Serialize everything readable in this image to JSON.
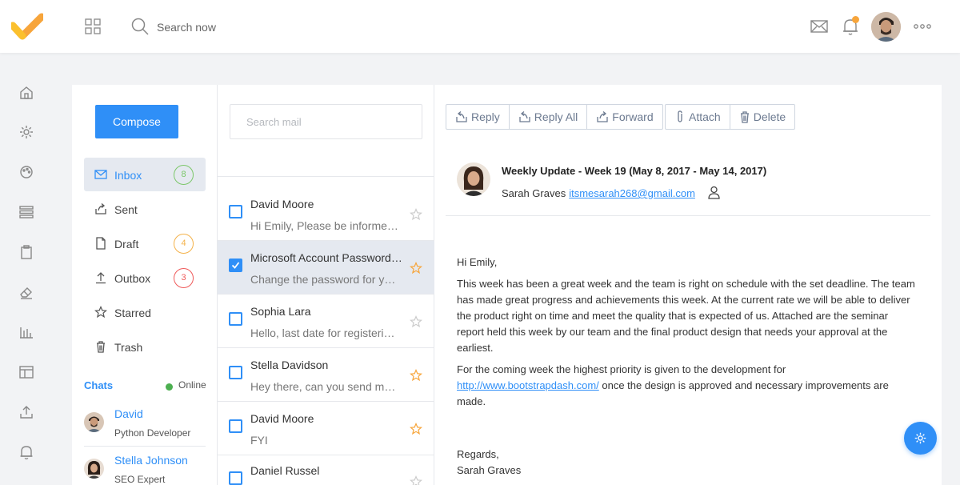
{
  "topbar": {
    "search_label": "Search now"
  },
  "colors": {
    "accent": "#2f8ff7",
    "logo_orange": "#f7a53b",
    "selected_row": "#e5e9f0",
    "badge_green": "#7cc76a",
    "badge_orange": "#f4b24a",
    "badge_red": "#ef5a5a"
  },
  "sidebar_rail": {
    "icons": [
      "home-icon",
      "settings-icon",
      "palette-icon",
      "list-icon",
      "clipboard-icon",
      "eraser-icon",
      "bar-chart-icon",
      "layout-icon",
      "upload-icon",
      "bell-icon"
    ]
  },
  "folders": {
    "compose_label": "Compose",
    "items": [
      {
        "label": "Inbox",
        "badge": "8",
        "icon": "mail-icon"
      },
      {
        "label": "Sent",
        "badge": "",
        "icon": "share-icon"
      },
      {
        "label": "Draft",
        "badge": "4",
        "icon": "file-icon"
      },
      {
        "label": "Outbox",
        "badge": "3",
        "icon": "upload-icon"
      },
      {
        "label": "Starred",
        "badge": "",
        "icon": "star-icon"
      },
      {
        "label": "Trash",
        "badge": "",
        "icon": "trash-icon"
      }
    ],
    "chats_title": "Chats",
    "online_label": "Online",
    "chats": [
      {
        "name": "David",
        "role": "Python Developer"
      },
      {
        "name": "Stella Johnson",
        "role": "SEO Expert"
      }
    ]
  },
  "message_list": {
    "search_placeholder": "Search mail",
    "messages": [
      {
        "sender": "David Moore",
        "preview": "Hi Emily, Please be informed t...",
        "checked": false,
        "starred": false
      },
      {
        "sender": "Microsoft Account Password ...",
        "preview": "Change the password for your...",
        "checked": true,
        "starred": true
      },
      {
        "sender": "Sophia Lara",
        "preview": "Hello, last date for registering ...",
        "checked": false,
        "starred": false
      },
      {
        "sender": "Stella Davidson",
        "preview": "Hey there, can you send me th...",
        "checked": false,
        "starred": true
      },
      {
        "sender": "David Moore",
        "preview": "FYI",
        "checked": false,
        "starred": true
      },
      {
        "sender": "Daniel Russel",
        "preview": "",
        "checked": false,
        "starred": false
      }
    ]
  },
  "toolbar": {
    "reply": "Reply",
    "reply_all": "Reply All",
    "forward": "Forward",
    "attach": "Attach",
    "delete": "Delete"
  },
  "reader": {
    "subject": "Weekly Update - Week 19 (May 8, 2017 - May 14, 2017)",
    "from_name": "Sarah Graves",
    "from_email": "itsmesarah268@gmail.com",
    "greeting": "Hi Emily,",
    "paragraph1": "This week has been a great week and the team is right on schedule with the set deadline. The team has made great progress and achievements this week. At the current rate we will be able to deliver the product right on time and meet the quality that is expected of us. Attached are the seminar report held this week by our team and the final product design that needs your approval at the earliest.",
    "paragraph2_start": "For the coming week the highest priority is given to the development for",
    "paragraph2_link": "http://www.bootstrapdash.com/",
    "paragraph2_end": " once the design is approved and necessary improvements are made.",
    "closing": "Regards,",
    "signature": "Sarah Graves"
  }
}
